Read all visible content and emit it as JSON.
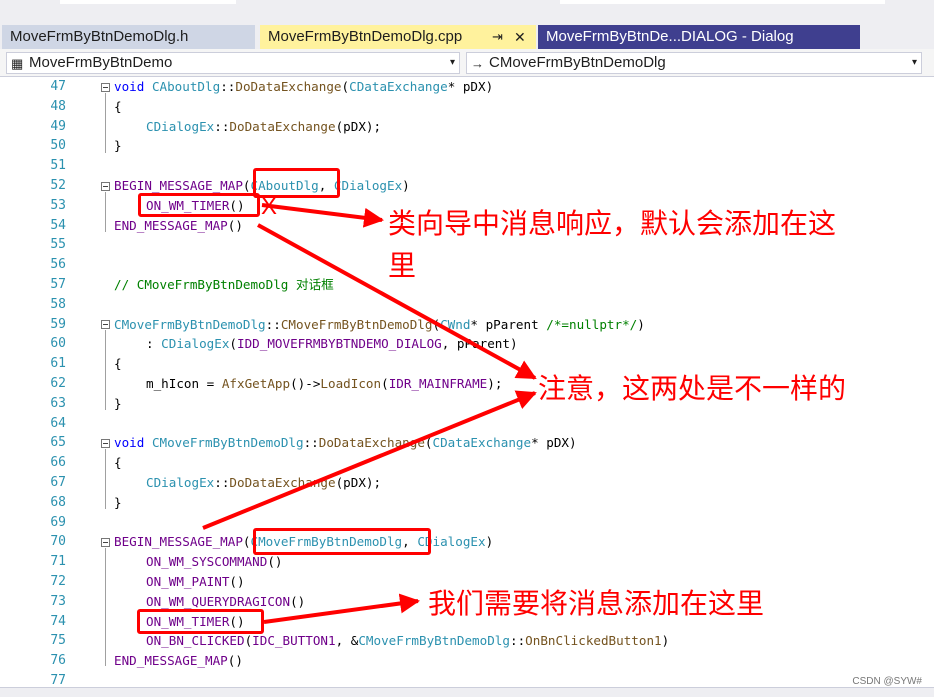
{
  "tabs": [
    {
      "label": "MoveFrmByBtnDemoDlg.h"
    },
    {
      "label": "MoveFrmByBtnDemoDlg.cpp",
      "pin": "⇥",
      "close": "✕"
    },
    {
      "label": "MoveFrmByBtnDe...DIALOG - Dialog"
    }
  ],
  "nav": {
    "scope": "MoveFrmByBtnDemo",
    "member": "CMoveFrmByBtnDemoDlg",
    "dropdown_glyph": "▾"
  },
  "line_numbers": [
    "47",
    "48",
    "49",
    "50",
    "51",
    "52",
    "53",
    "54",
    "55",
    "56",
    "57",
    "58",
    "59",
    "60",
    "61",
    "62",
    "63",
    "64",
    "65",
    "66",
    "67",
    "68",
    "69",
    "70",
    "71",
    "72",
    "73",
    "74",
    "75",
    "76",
    "77"
  ],
  "code": {
    "l47": {
      "kw": "void",
      "cls": "CAboutDlg",
      "sep": "::",
      "fn": "DoDataExchange",
      "p1": "(",
      "ty": "CDataExchange",
      "p2": "* pDX)"
    },
    "l48": "{",
    "l49": {
      "cls": "CDialogEx",
      "sep": "::",
      "fn": "DoDataExchange",
      "rest": "(pDX);"
    },
    "l50": "}",
    "l52": {
      "mac": "BEGIN_MESSAGE_MAP",
      "p": "(",
      "a1": "CAboutDlg",
      "c": ", ",
      "a2": "CDialogEx",
      "e": ")"
    },
    "l53": {
      "mac": "ON_WM_TIMER",
      "rest": "()"
    },
    "l54": {
      "mac": "END_MESSAGE_MAP",
      "rest": "()"
    },
    "l57": "// CMoveFrmByBtnDemoDlg 对话框",
    "l59": {
      "cls": "CMoveFrmByBtnDemoDlg",
      "sep": "::",
      "fn": "CMoveFrmByBtnDemoDlg",
      "p1": "(",
      "ty": "CWnd",
      "p2": "* pParent ",
      "cm": "/*=nullptr*/",
      "e": ")"
    },
    "l60": {
      "pre": ": ",
      "cls": "CDialogEx",
      "p": "(",
      "mac": "IDD_MOVEFRMBYBTNDEMO_DIALOG",
      "rest": ", pParent)"
    },
    "l61": "{",
    "l62": {
      "pre": "m_hIcon = ",
      "fn1": "AfxGetApp",
      "mid": "()->",
      "fn2": "LoadIcon",
      "p": "(",
      "mac": "IDR_MAINFRAME",
      "rest": ");"
    },
    "l63": "}",
    "l65": {
      "kw": "void",
      "cls": "CMoveFrmByBtnDemoDlg",
      "sep": "::",
      "fn": "DoDataExchange",
      "p1": "(",
      "ty": "CDataExchange",
      "p2": "* pDX)"
    },
    "l66": "{",
    "l67": {
      "cls": "CDialogEx",
      "sep": "::",
      "fn": "DoDataExchange",
      "rest": "(pDX);"
    },
    "l68": "}",
    "l70": {
      "mac": "BEGIN_MESSAGE_MAP",
      "p": "(",
      "a1": "CMoveFrmByBtnDemoDlg",
      "c": ", ",
      "a2": "CDialogEx",
      "e": ")"
    },
    "l71": {
      "mac": "ON_WM_SYSCOMMAND",
      "rest": "()"
    },
    "l72": {
      "mac": "ON_WM_PAINT",
      "rest": "()"
    },
    "l73": {
      "mac": "ON_WM_QUERYDRAGICON",
      "rest": "()"
    },
    "l74": {
      "mac": "ON_WM_TIMER",
      "rest": "()"
    },
    "l75": {
      "mac": "ON_BN_CLICKED",
      "p": "(",
      "m2": "IDC_BUTTON1",
      "c": ", &",
      "cls": "CMoveFrmByBtnDemoDlg",
      "sep": "::",
      "fn": "OnBnClickedButton1",
      "e": ")"
    },
    "l76": {
      "mac": "END_MESSAGE_MAP",
      "rest": "()"
    }
  },
  "annotations": {
    "note1_line1": "类向导中消息响应，默认会添加在这",
    "note1_line2": "里",
    "note2": "注意，这两处是不一样的",
    "note3": "我们需要将消息添加在这里",
    "x_mark": "X",
    "color": "#ff0000"
  },
  "watermark": "CSDN @SYW#"
}
